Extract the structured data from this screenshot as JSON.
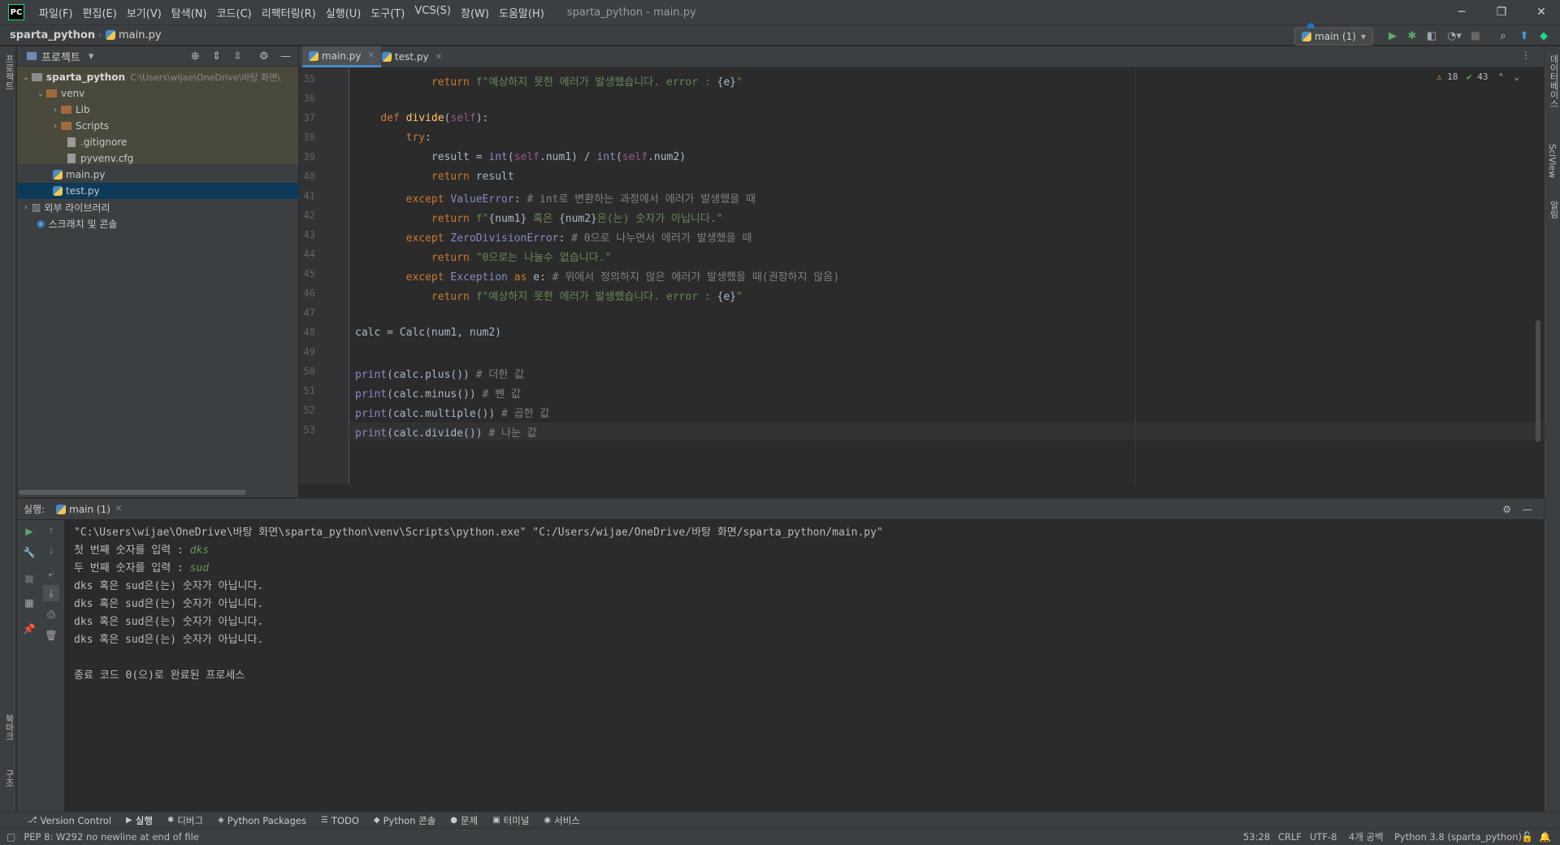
{
  "titlebar": {
    "logo": "PC",
    "menus": [
      "파일(F)",
      "편집(E)",
      "보기(V)",
      "탐색(N)",
      "코드(C)",
      "리팩터링(R)",
      "실행(U)",
      "도구(T)",
      "VCS(S)",
      "창(W)",
      "도움말(H)"
    ],
    "title": "sparta_python - main.py",
    "minimize": "─",
    "restore": "❐",
    "close": "✕"
  },
  "navbar": {
    "project": "sparta_python",
    "file": "main.py",
    "run_config": "main (1)"
  },
  "leftstrip": {
    "project_label": "프로젝트",
    "bookmarks_label": "북마크",
    "structure_label": "구조"
  },
  "rightstrip": {
    "database_label": "데이터베이스",
    "sciview_label": "SciView",
    "notifications_label": "알림"
  },
  "project_panel": {
    "title": "프로젝트",
    "root_name": "sparta_python",
    "root_path": "C:\\Users\\wijae\\OneDrive\\바탕 화면\\",
    "venv": "venv",
    "lib": "Lib",
    "scripts": "Scripts",
    "gitignore": ".gitignore",
    "pyvenv": "pyvenv.cfg",
    "main": "main.py",
    "test": "test.py",
    "external": "외부 라이브러리",
    "scratches": "스크래치 및 콘솔"
  },
  "editor": {
    "tabs": [
      {
        "label": "main.py"
      },
      {
        "label": "test.py"
      }
    ],
    "warnings": "18",
    "weak_warnings": "43",
    "lines": [
      {
        "n": "35",
        "segs": [
          {
            "t": "            "
          },
          {
            "t": "return ",
            "c": "kw"
          },
          {
            "t": "f\"예상하지 못한 에러가 발생했습니다. error : ",
            "c": "str"
          },
          {
            "t": "{e}"
          },
          {
            "t": "\"",
            "c": "str"
          }
        ]
      },
      {
        "n": "36",
        "segs": [
          {
            "t": ""
          }
        ]
      },
      {
        "n": "37",
        "segs": [
          {
            "t": "    "
          },
          {
            "t": "def ",
            "c": "kw"
          },
          {
            "t": "divide",
            "c": "fn"
          },
          {
            "t": "("
          },
          {
            "t": "self",
            "c": "self"
          },
          {
            "t": "):"
          }
        ]
      },
      {
        "n": "38",
        "segs": [
          {
            "t": "        "
          },
          {
            "t": "try",
            "c": "kw"
          },
          {
            "t": ":"
          }
        ]
      },
      {
        "n": "39",
        "segs": [
          {
            "t": "            result = "
          },
          {
            "t": "int",
            "c": "bi"
          },
          {
            "t": "("
          },
          {
            "t": "self",
            "c": "self"
          },
          {
            "t": ".num1) / "
          },
          {
            "t": "int",
            "c": "bi"
          },
          {
            "t": "("
          },
          {
            "t": "self",
            "c": "self"
          },
          {
            "t": ".num2)"
          }
        ]
      },
      {
        "n": "40",
        "segs": [
          {
            "t": "            "
          },
          {
            "t": "return ",
            "c": "kw"
          },
          {
            "t": "result"
          }
        ]
      },
      {
        "n": "41",
        "segs": [
          {
            "t": "        "
          },
          {
            "t": "except ",
            "c": "kw"
          },
          {
            "t": "ValueError",
            "c": "bi"
          },
          {
            "t": ": "
          },
          {
            "t": "# int로 변환하는 과정에서 에러가 발생했을 때",
            "c": "cmt"
          }
        ]
      },
      {
        "n": "42",
        "segs": [
          {
            "t": "            "
          },
          {
            "t": "return ",
            "c": "kw"
          },
          {
            "t": "f\"",
            "c": "str"
          },
          {
            "t": "{num1}"
          },
          {
            "t": " 혹은 ",
            "c": "str"
          },
          {
            "t": "{num2}"
          },
          {
            "t": "은(는) 숫자가 아닙니다.\"",
            "c": "str"
          }
        ]
      },
      {
        "n": "43",
        "segs": [
          {
            "t": "        "
          },
          {
            "t": "except ",
            "c": "kw"
          },
          {
            "t": "ZeroDivisionError",
            "c": "bi"
          },
          {
            "t": ": "
          },
          {
            "t": "# 0으로 나누면서 에러가 발생했을 때",
            "c": "cmt"
          }
        ]
      },
      {
        "n": "44",
        "segs": [
          {
            "t": "            "
          },
          {
            "t": "return ",
            "c": "kw"
          },
          {
            "t": "\"0으로는 나눌수 없습니다.\"",
            "c": "str"
          }
        ]
      },
      {
        "n": "45",
        "segs": [
          {
            "t": "        "
          },
          {
            "t": "except ",
            "c": "kw"
          },
          {
            "t": "Exception ",
            "c": "bi"
          },
          {
            "t": "as ",
            "c": "kw"
          },
          {
            "t": "e: "
          },
          {
            "t": "# 위에서 정의하지 않은 에러가 발생했을 때(권장하지 않음)",
            "c": "cmt"
          }
        ]
      },
      {
        "n": "46",
        "segs": [
          {
            "t": "            "
          },
          {
            "t": "return ",
            "c": "kw"
          },
          {
            "t": "f\"예상하지 못한 에러가 발생했습니다. error : ",
            "c": "str"
          },
          {
            "t": "{e}"
          },
          {
            "t": "\"",
            "c": "str"
          }
        ]
      },
      {
        "n": "47",
        "segs": [
          {
            "t": ""
          }
        ]
      },
      {
        "n": "48",
        "segs": [
          {
            "t": "calc = Calc(num1, num2)"
          }
        ]
      },
      {
        "n": "49",
        "segs": [
          {
            "t": ""
          }
        ]
      },
      {
        "n": "50",
        "segs": [
          {
            "t": "print",
            "c": "bi"
          },
          {
            "t": "(calc.plus()) "
          },
          {
            "t": "# 더한 값",
            "c": "cmt"
          }
        ]
      },
      {
        "n": "51",
        "segs": [
          {
            "t": "print",
            "c": "bi"
          },
          {
            "t": "(calc.minus()) "
          },
          {
            "t": "# 뺀 값",
            "c": "cmt"
          }
        ]
      },
      {
        "n": "52",
        "segs": [
          {
            "t": "print",
            "c": "bi"
          },
          {
            "t": "(calc.multiple()) "
          },
          {
            "t": "# 곱한 값",
            "c": "cmt"
          }
        ]
      },
      {
        "n": "53",
        "segs": [
          {
            "t": "print",
            "c": "bi"
          },
          {
            "t": "(calc.divide()) "
          },
          {
            "t": "# 나눈 값",
            "c": "cmt"
          }
        ]
      }
    ]
  },
  "run_panel": {
    "label": "실행:",
    "tab": "main (1)",
    "output": [
      {
        "t": "\"C:\\Users\\wijae\\OneDrive\\바탕 화면\\sparta_python\\venv\\Scripts\\python.exe\" \"C:/Users/wijae/OneDrive/바탕 화면/sparta_python/main.py\""
      },
      {
        "t": "첫 번째 숫자를 입력 : ",
        "input": "dks"
      },
      {
        "t": "두 번째 숫자를 입력 : ",
        "input": "sud"
      },
      {
        "t": "dks 혹은 sud은(는) 숫자가 아닙니다."
      },
      {
        "t": "dks 혹은 sud은(는) 숫자가 아닙니다."
      },
      {
        "t": "dks 혹은 sud은(는) 숫자가 아닙니다."
      },
      {
        "t": "dks 혹은 sud은(는) 숫자가 아닙니다."
      },
      {
        "t": ""
      },
      {
        "t": "종료 코드 0(으)로 완료된 프로세스"
      }
    ]
  },
  "bottom_tools": [
    "Version Control",
    "실행",
    "디버그",
    "Python Packages",
    "TODO",
    "Python 콘솔",
    "문제",
    "터미널",
    "서비스"
  ],
  "status": {
    "message": "PEP 8: W292 no newline at end of file",
    "position": "53:28",
    "line_sep": "CRLF",
    "encoding": "UTF-8",
    "indent": "4개 공백",
    "interpreter": "Python 3.8 (sparta_python)"
  }
}
